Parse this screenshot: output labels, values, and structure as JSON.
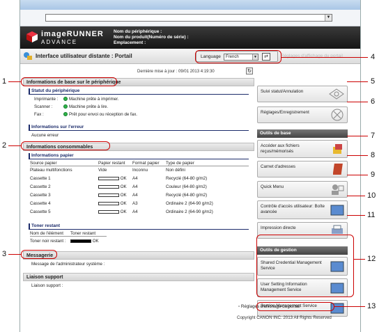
{
  "header": {
    "brand_top": "imageRUNNER",
    "brand_bottom": "ADVANCE",
    "device_name_label": "Nom du périphérique :",
    "product_name_label": "Nom du produit(Numéro de série) :",
    "location_label": "Emplacement :"
  },
  "titlebar": {
    "title": "Interface utilisateur distante : Portail",
    "language_label": "Language",
    "language_value": "French",
    "hint": "Réglages d'affichage du portail"
  },
  "main": {
    "last_update": "Dernière mise à jour : 09/01 2013 4:19:30",
    "device_basic_info": "Informations de base sur le périphérique",
    "device_status": "Statut du périphérique",
    "status_rows": [
      {
        "label": "Imprimante :",
        "value": "Machine prête à imprimer."
      },
      {
        "label": "Scanner :",
        "value": "Machine prête à lire."
      },
      {
        "label": "Fax :",
        "value": "Prêt pour envoi ou réception de fax."
      }
    ],
    "error_info": "Informations sur l'erreur",
    "error_value": "Aucune erreur",
    "consumables": "Informations consommables",
    "paper_info": "Informations papier",
    "paper_headers": [
      "Source papier",
      "Papier restant",
      "Format papier",
      "Type de papier"
    ],
    "paper_rows": [
      {
        "source": "Plateau multifonctions",
        "remaining": "Vide",
        "format": "Inconnu",
        "type": "Non défini",
        "bar": false
      },
      {
        "source": "Cassette 1",
        "remaining": "OK",
        "format": "A4",
        "type": "Recyclé (64-80 g/m2)",
        "bar": true
      },
      {
        "source": "Cassette 2",
        "remaining": "OK",
        "format": "A4",
        "type": "Couleur (64-80 g/m2)",
        "bar": true
      },
      {
        "source": "Cassette 3",
        "remaining": "OK",
        "format": "A4",
        "type": "Recyclé (64-80 g/m2)",
        "bar": true
      },
      {
        "source": "Cassette 4",
        "remaining": "OK",
        "format": "A3",
        "type": "Ordinaire 2 (64-90 g/m2)",
        "bar": true
      },
      {
        "source": "Cassette 5",
        "remaining": "OK",
        "format": "A4",
        "type": "Ordinaire 2 (64-90 g/m2)",
        "bar": true
      }
    ],
    "toner_title": "Toner restant",
    "toner_headers": [
      "Nom de l'élément",
      "Toner restant"
    ],
    "toner_label": "Toner noir restant :",
    "toner_status": "OK",
    "messaging": "Messagerie",
    "admin_message": "Message de l'administrateur système :",
    "support_link": "Liaison support",
    "support_value": "Liaison support :"
  },
  "side": {
    "status_cancel": "Suivi statut/Annulation",
    "settings": "Réglages/Enregistrement",
    "basic_tools": "Outils de base",
    "mailbox": "Accéder aux fichiers reçus/mémorisés",
    "address_book": "Carnet d'adresses",
    "quick_menu": "Quick Menu",
    "access_control": "Contrôle d'accès utilisateur: Boîte avancée",
    "direct_print": "Impression directe",
    "mgmt_tools": "Outils de gestion",
    "shared_cred": "Shared Credential Management Service",
    "user_setting": "User Setting Information Management Service",
    "service_mgmt": "Service Management Service",
    "portal_settings": "Réglages d'affichage du portail",
    "copyright": "Copyright CANON INC. 2013 All Rights Reserved"
  },
  "callouts": [
    "1",
    "2",
    "3",
    "4",
    "5",
    "6",
    "7",
    "8",
    "9",
    "10",
    "11",
    "12",
    "13"
  ]
}
